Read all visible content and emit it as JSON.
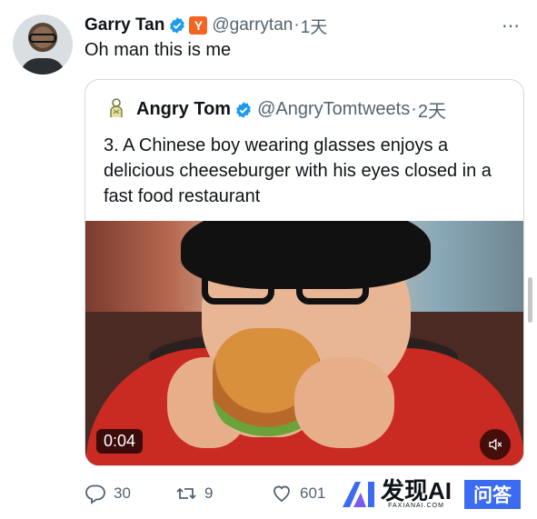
{
  "author": {
    "name": "Garry Tan",
    "handle": "@garrytan",
    "separator": "·",
    "time": "1天",
    "badge": "Y"
  },
  "tweet": {
    "text": "Oh man this is me"
  },
  "more_icon": "⋯",
  "quote": {
    "name": "Angry Tom",
    "handle": "@AngryTomtweets",
    "separator": "·",
    "time": "2天",
    "text": "3. A Chinese boy wearing glasses enjoys a delicious cheeseburger with his eyes closed in a fast food restaurant",
    "media": {
      "duration": "0:04",
      "mute_icon": "speaker-muted-icon"
    }
  },
  "actions": {
    "replies": "30",
    "retweets": "9",
    "likes": "601"
  },
  "watermark": {
    "title": "发现AI",
    "subtitle": "FAXIANAI.COM",
    "qa": "问答"
  },
  "colors": {
    "verified": "#1d9bf0",
    "yc_badge": "#f26522",
    "muted_text": "#536471",
    "brand_blue": "#3b6bf0"
  }
}
